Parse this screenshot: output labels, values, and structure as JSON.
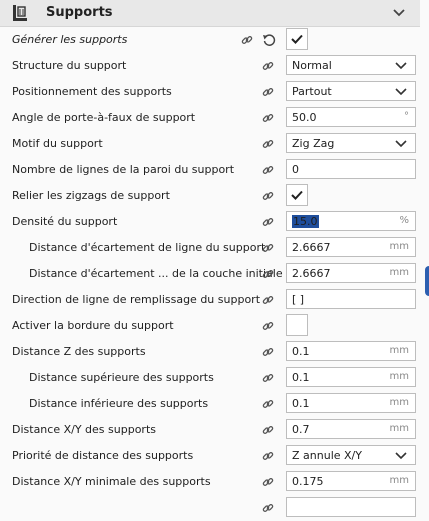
{
  "section": {
    "title": "Supports",
    "icon": "support-category-icon",
    "collapse_icon": "chevron-down-icon"
  },
  "settings": [
    {
      "label": "Générer les supports",
      "italic": true,
      "indent": false,
      "control": "checkbox",
      "checked": true,
      "reset": true
    },
    {
      "label": "Structure du support",
      "indent": false,
      "control": "dropdown",
      "value": "Normal"
    },
    {
      "label": "Positionnement des supports",
      "indent": false,
      "control": "dropdown",
      "value": "Partout"
    },
    {
      "label": "Angle de porte-à-faux de support",
      "indent": false,
      "control": "text",
      "value": "50.0",
      "unit": "°"
    },
    {
      "label": "Motif du support",
      "indent": false,
      "control": "dropdown",
      "value": "Zig Zag"
    },
    {
      "label": "Nombre de lignes de la paroi du support",
      "indent": false,
      "control": "text",
      "value": "0",
      "unit": ""
    },
    {
      "label": "Relier les zigzags de support",
      "indent": false,
      "control": "checkbox",
      "checked": true
    },
    {
      "label": "Densité du support",
      "indent": false,
      "control": "text",
      "value": "15.0",
      "unit": "%",
      "selected": true
    },
    {
      "label": "Distance d'écartement de ligne du support",
      "indent": true,
      "control": "text",
      "value": "2.6667",
      "unit": "mm"
    },
    {
      "label": "Distance d'écartement ... de la couche initiale",
      "indent": true,
      "control": "text",
      "value": "2.6667",
      "unit": "mm"
    },
    {
      "label": "Direction de ligne de remplissage du support",
      "indent": false,
      "control": "text",
      "value": "[ ]",
      "unit": ""
    },
    {
      "label": "Activer la bordure du support",
      "indent": false,
      "control": "checkbox",
      "checked": false
    },
    {
      "label": "Distance Z des supports",
      "indent": false,
      "control": "text",
      "value": "0.1",
      "unit": "mm"
    },
    {
      "label": "Distance supérieure des supports",
      "indent": true,
      "control": "text",
      "value": "0.1",
      "unit": "mm"
    },
    {
      "label": "Distance inférieure des supports",
      "indent": true,
      "control": "text",
      "value": "0.1",
      "unit": "mm"
    },
    {
      "label": "Distance X/Y des supports",
      "indent": false,
      "control": "text",
      "value": "0.7",
      "unit": "mm"
    },
    {
      "label": "Priorité de distance des supports",
      "indent": false,
      "control": "dropdown",
      "value": "Z annule X/Y"
    },
    {
      "label": "Distance X/Y minimale des supports",
      "indent": false,
      "control": "text",
      "value": "0.175",
      "unit": "mm"
    },
    {
      "label": "",
      "indent": false,
      "control": "text",
      "value": "",
      "unit": ""
    }
  ],
  "colors": {
    "accent": "#1f4e9c",
    "edge_tab": "#2c5fb0"
  }
}
